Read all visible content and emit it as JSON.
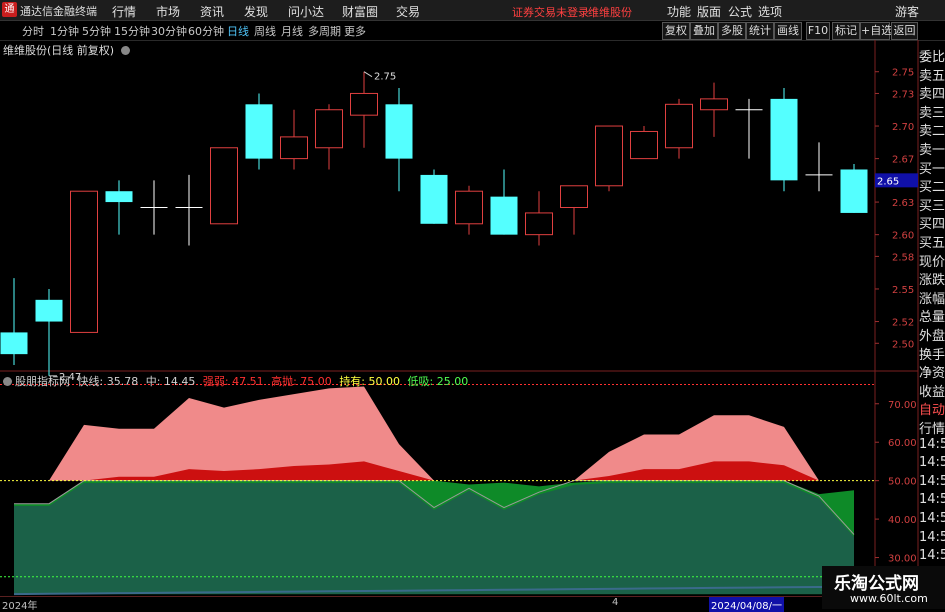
{
  "app": {
    "title": "通达信金融终端",
    "menus": [
      "行情",
      "市场",
      "资讯",
      "发现",
      "问小达",
      "财富圈",
      "交易"
    ],
    "status_notice": "证券交易未登录",
    "stock_notice": "维维股份",
    "right_menus": [
      "功能",
      "版面",
      "公式",
      "选项"
    ],
    "guest": "游客"
  },
  "periods": {
    "items": [
      "分时",
      "1分钟",
      "5分钟",
      "15分钟",
      "30分钟",
      "60分钟",
      "日线",
      "周线",
      "月线",
      "多周期",
      "更多"
    ],
    "active": "日线"
  },
  "toolbar": {
    "buttons": [
      "复权",
      "叠加",
      "多股",
      "统计",
      "画线",
      "F10",
      "标记",
      "+自选",
      "返回"
    ]
  },
  "stock": {
    "title": "维维股份(日线 前复权)",
    "current_price_label": "2.65",
    "high_label": "2.75",
    "low_label": "2.47"
  },
  "colors": {
    "up": "#e04040",
    "down": "#54ffff",
    "cross": "#ffffff",
    "background": "#000000",
    "accent": "#4fc3f7",
    "price_box": "#1010a8"
  },
  "chart_data": {
    "type": "candlestick",
    "y_ticks": [
      "2.75",
      "2.73",
      "2.70",
      "2.67",
      "2.65",
      "2.63",
      "2.60",
      "2.58",
      "2.55",
      "2.52",
      "2.50"
    ],
    "ylim": [
      2.48,
      2.77
    ],
    "candles": [
      {
        "o": 2.51,
        "c": 2.49,
        "h": 2.56,
        "l": 2.48
      },
      {
        "o": 2.54,
        "c": 2.52,
        "h": 2.55,
        "l": 2.47
      },
      {
        "o": 2.51,
        "c": 2.64,
        "h": 2.64,
        "l": 2.51
      },
      {
        "o": 2.64,
        "c": 2.63,
        "h": 2.65,
        "l": 2.6
      },
      {
        "o": 2.625,
        "c": 2.625,
        "h": 2.65,
        "l": 2.6
      },
      {
        "o": 2.625,
        "c": 2.625,
        "h": 2.655,
        "l": 2.59
      },
      {
        "o": 2.61,
        "c": 2.68,
        "h": 2.68,
        "l": 2.61
      },
      {
        "o": 2.72,
        "c": 2.67,
        "h": 2.73,
        "l": 2.66
      },
      {
        "o": 2.67,
        "c": 2.69,
        "h": 2.715,
        "l": 2.66
      },
      {
        "o": 2.68,
        "c": 2.715,
        "h": 2.72,
        "l": 2.66
      },
      {
        "o": 2.71,
        "c": 2.73,
        "h": 2.75,
        "l": 2.68
      },
      {
        "o": 2.72,
        "c": 2.67,
        "h": 2.735,
        "l": 2.64
      },
      {
        "o": 2.655,
        "c": 2.61,
        "h": 2.66,
        "l": 2.61
      },
      {
        "o": 2.61,
        "c": 2.64,
        "h": 2.645,
        "l": 2.6
      },
      {
        "o": 2.635,
        "c": 2.6,
        "h": 2.66,
        "l": 2.6
      },
      {
        "o": 2.6,
        "c": 2.62,
        "h": 2.64,
        "l": 2.59
      },
      {
        "o": 2.625,
        "c": 2.645,
        "h": 2.645,
        "l": 2.6
      },
      {
        "o": 2.645,
        "c": 2.7,
        "h": 2.7,
        "l": 2.64
      },
      {
        "o": 2.67,
        "c": 2.695,
        "h": 2.7,
        "l": 2.67
      },
      {
        "o": 2.68,
        "c": 2.72,
        "h": 2.725,
        "l": 2.67
      },
      {
        "o": 2.715,
        "c": 2.725,
        "h": 2.74,
        "l": 2.69
      },
      {
        "o": 2.715,
        "c": 2.715,
        "h": 2.725,
        "l": 2.67
      },
      {
        "o": 2.725,
        "c": 2.65,
        "h": 2.735,
        "l": 2.64
      },
      {
        "o": 2.655,
        "c": 2.655,
        "h": 2.685,
        "l": 2.64
      },
      {
        "o": 2.66,
        "c": 2.62,
        "h": 2.665,
        "l": 2.62
      }
    ]
  },
  "indicator": {
    "name": "股朋指标网",
    "items": [
      {
        "label": "快线: 35.78",
        "color": "#d0d0d0"
      },
      {
        "label": "中: 14.45",
        "color": "#d0d0d0"
      },
      {
        "label": "强弱: 47.51",
        "color": "#ff3030"
      },
      {
        "label": "高抛: 75.00",
        "color": "#ff3030"
      },
      {
        "label": "持有: 50.00",
        "color": "#ffff40"
      },
      {
        "label": "低吸: 25.00",
        "color": "#50ff50"
      }
    ],
    "y_ticks": [
      "70.00",
      "60.00",
      "50.00",
      "40.00",
      "30.00"
    ],
    "ylim": [
      20,
      78
    ],
    "pink": [
      50,
      50,
      64.5,
      63.5,
      63.5,
      71.5,
      69,
      71,
      72.5,
      74,
      74.5,
      59.5,
      50,
      50,
      50,
      50,
      50,
      57.5,
      62,
      62,
      67,
      67,
      64,
      50,
      50
    ],
    "red": [
      50,
      50,
      50,
      51,
      51,
      53,
      52.5,
      53,
      53.8,
      54.2,
      55,
      52.5,
      50,
      50,
      50,
      50,
      50,
      51.2,
      53,
      53,
      55,
      55,
      54,
      50,
      50
    ],
    "green": [
      44,
      44,
      50,
      50,
      50,
      50,
      50,
      50,
      50,
      50,
      50,
      50,
      50,
      49,
      49.5,
      48.5,
      49.5,
      50,
      50,
      50,
      50,
      50,
      50,
      46.5,
      47.5
    ],
    "quick": [
      44,
      44,
      50,
      50,
      50,
      50,
      50,
      50,
      50,
      50,
      50,
      50,
      43,
      48,
      43,
      47,
      50,
      50,
      50,
      50,
      50,
      50,
      50,
      46,
      36
    ]
  },
  "right_panel": {
    "labels": [
      "委比",
      "卖五",
      "卖四",
      "卖三",
      "卖二",
      "卖一",
      "买一",
      "买二",
      "买三",
      "买四",
      "买五",
      "现价",
      "涨跌",
      "涨幅",
      "总量",
      "外盘",
      "换手",
      "净资",
      "收益",
      "自动",
      "行情",
      "14:5",
      "14:5",
      "14:5",
      "14:5",
      "14:5",
      "14:5",
      "14:5",
      "14:5",
      "14:5"
    ]
  },
  "dates": {
    "year_label": "2024年",
    "mid_label": "4",
    "date_label": "2024/04/08/一"
  },
  "watermark": {
    "title": "乐淘公式网",
    "url": "www.60lt.com"
  }
}
